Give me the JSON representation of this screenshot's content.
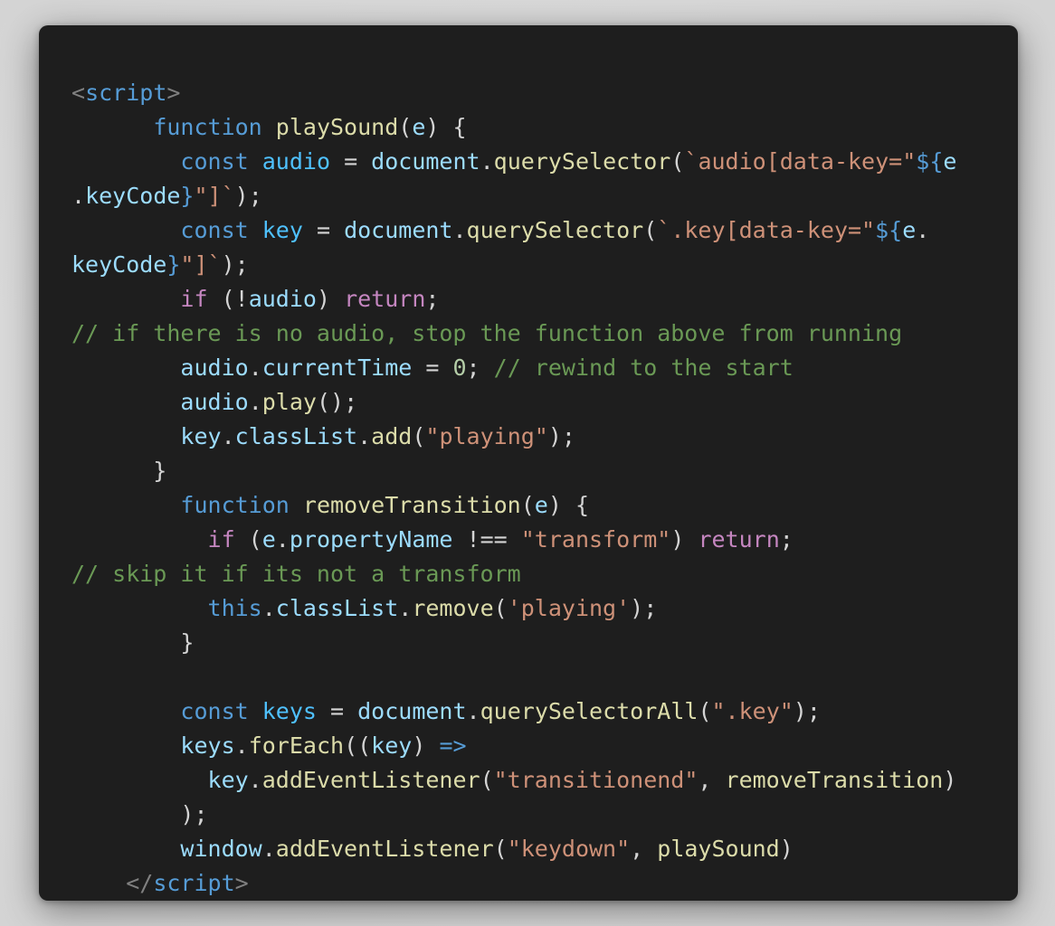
{
  "code_lines": [
    [
      [
        "punct-tag",
        "<"
      ],
      [
        "tag",
        "script"
      ],
      [
        "punct-tag",
        ">"
      ]
    ],
    [
      [
        "plain",
        "      "
      ],
      [
        "kw",
        "function"
      ],
      [
        "plain",
        " "
      ],
      [
        "fn",
        "playSound"
      ],
      [
        "plain",
        "("
      ],
      [
        "var",
        "e"
      ],
      [
        "plain",
        ") {"
      ]
    ],
    [
      [
        "plain",
        "        "
      ],
      [
        "kw",
        "const"
      ],
      [
        "plain",
        " "
      ],
      [
        "const",
        "audio"
      ],
      [
        "plain",
        " = "
      ],
      [
        "var",
        "document"
      ],
      [
        "plain",
        "."
      ],
      [
        "fn",
        "querySelector"
      ],
      [
        "plain",
        "("
      ],
      [
        "str",
        "`audio[data-key=\""
      ],
      [
        "interp",
        "${"
      ],
      [
        "var",
        "e"
      ]
    ],
    [
      [
        "plain",
        "."
      ],
      [
        "var",
        "keyCode"
      ],
      [
        "interp",
        "}"
      ],
      [
        "str",
        "\"]`"
      ],
      [
        "plain",
        ");"
      ]
    ],
    [
      [
        "plain",
        "        "
      ],
      [
        "kw",
        "const"
      ],
      [
        "plain",
        " "
      ],
      [
        "const",
        "key"
      ],
      [
        "plain",
        " = "
      ],
      [
        "var",
        "document"
      ],
      [
        "plain",
        "."
      ],
      [
        "fn",
        "querySelector"
      ],
      [
        "plain",
        "("
      ],
      [
        "str",
        "`.key[data-key=\""
      ],
      [
        "interp",
        "${"
      ],
      [
        "var",
        "e"
      ],
      [
        "plain",
        "."
      ]
    ],
    [
      [
        "var",
        "keyCode"
      ],
      [
        "interp",
        "}"
      ],
      [
        "str",
        "\"]`"
      ],
      [
        "plain",
        ");"
      ]
    ],
    [
      [
        "plain",
        "        "
      ],
      [
        "ctl",
        "if"
      ],
      [
        "plain",
        " (!"
      ],
      [
        "var",
        "audio"
      ],
      [
        "plain",
        ") "
      ],
      [
        "ctl",
        "return"
      ],
      [
        "plain",
        ";"
      ]
    ],
    [
      [
        "cmt",
        "// if there is no audio, stop the function above from running"
      ]
    ],
    [
      [
        "plain",
        "        "
      ],
      [
        "var",
        "audio"
      ],
      [
        "plain",
        "."
      ],
      [
        "var",
        "currentTime"
      ],
      [
        "plain",
        " = "
      ],
      [
        "num",
        "0"
      ],
      [
        "plain",
        "; "
      ],
      [
        "cmt",
        "// rewind to the start"
      ]
    ],
    [
      [
        "plain",
        "        "
      ],
      [
        "var",
        "audio"
      ],
      [
        "plain",
        "."
      ],
      [
        "fn",
        "play"
      ],
      [
        "plain",
        "();"
      ]
    ],
    [
      [
        "plain",
        "        "
      ],
      [
        "var",
        "key"
      ],
      [
        "plain",
        "."
      ],
      [
        "var",
        "classList"
      ],
      [
        "plain",
        "."
      ],
      [
        "fn",
        "add"
      ],
      [
        "plain",
        "("
      ],
      [
        "str",
        "\"playing\""
      ],
      [
        "plain",
        ");"
      ]
    ],
    [
      [
        "plain",
        "      }"
      ]
    ],
    [
      [
        "plain",
        "        "
      ],
      [
        "kw",
        "function"
      ],
      [
        "plain",
        " "
      ],
      [
        "fn",
        "removeTransition"
      ],
      [
        "plain",
        "("
      ],
      [
        "var",
        "e"
      ],
      [
        "plain",
        ") {"
      ]
    ],
    [
      [
        "plain",
        "          "
      ],
      [
        "ctl",
        "if"
      ],
      [
        "plain",
        " ("
      ],
      [
        "var",
        "e"
      ],
      [
        "plain",
        "."
      ],
      [
        "var",
        "propertyName"
      ],
      [
        "plain",
        " !== "
      ],
      [
        "str",
        "\"transform\""
      ],
      [
        "plain",
        ") "
      ],
      [
        "ctl",
        "return"
      ],
      [
        "plain",
        ";"
      ]
    ],
    [
      [
        "cmt",
        "// skip it if its not a transform"
      ]
    ],
    [
      [
        "plain",
        "          "
      ],
      [
        "kw",
        "this"
      ],
      [
        "plain",
        "."
      ],
      [
        "var",
        "classList"
      ],
      [
        "plain",
        "."
      ],
      [
        "fn",
        "remove"
      ],
      [
        "plain",
        "("
      ],
      [
        "str",
        "'playing'"
      ],
      [
        "plain",
        ");"
      ]
    ],
    [
      [
        "plain",
        "        }"
      ]
    ],
    [
      [
        "plain",
        ""
      ]
    ],
    [
      [
        "plain",
        "        "
      ],
      [
        "kw",
        "const"
      ],
      [
        "plain",
        " "
      ],
      [
        "const",
        "keys"
      ],
      [
        "plain",
        " = "
      ],
      [
        "var",
        "document"
      ],
      [
        "plain",
        "."
      ],
      [
        "fn",
        "querySelectorAll"
      ],
      [
        "plain",
        "("
      ],
      [
        "str",
        "\".key\""
      ],
      [
        "plain",
        ");"
      ]
    ],
    [
      [
        "plain",
        "        "
      ],
      [
        "var",
        "keys"
      ],
      [
        "plain",
        "."
      ],
      [
        "fn",
        "forEach"
      ],
      [
        "plain",
        "(("
      ],
      [
        "var",
        "key"
      ],
      [
        "plain",
        ") "
      ],
      [
        "kw",
        "=>"
      ]
    ],
    [
      [
        "plain",
        "          "
      ],
      [
        "var",
        "key"
      ],
      [
        "plain",
        "."
      ],
      [
        "fn",
        "addEventListener"
      ],
      [
        "plain",
        "("
      ],
      [
        "str",
        "\"transitionend\""
      ],
      [
        "plain",
        ", "
      ],
      [
        "fn",
        "removeTransition"
      ],
      [
        "plain",
        ")"
      ]
    ],
    [
      [
        "plain",
        "        );"
      ]
    ],
    [
      [
        "plain",
        "        "
      ],
      [
        "var",
        "window"
      ],
      [
        "plain",
        "."
      ],
      [
        "fn",
        "addEventListener"
      ],
      [
        "plain",
        "("
      ],
      [
        "str",
        "\"keydown\""
      ],
      [
        "plain",
        ", "
      ],
      [
        "fn",
        "playSound"
      ],
      [
        "plain",
        ")"
      ]
    ],
    [
      [
        "plain",
        "    "
      ],
      [
        "punct-tag",
        "</"
      ],
      [
        "tag",
        "script"
      ],
      [
        "punct-tag",
        ">"
      ]
    ]
  ],
  "colors": {
    "background": "#1e1e1e",
    "keyword": "#569cd6",
    "control": "#c586c0",
    "function": "#dcdcaa",
    "variable": "#9cdcfe",
    "constant": "#4fc1ff",
    "string": "#ce9178",
    "number": "#b5cea8",
    "comment": "#6a9955",
    "plain": "#d4d4d4"
  }
}
